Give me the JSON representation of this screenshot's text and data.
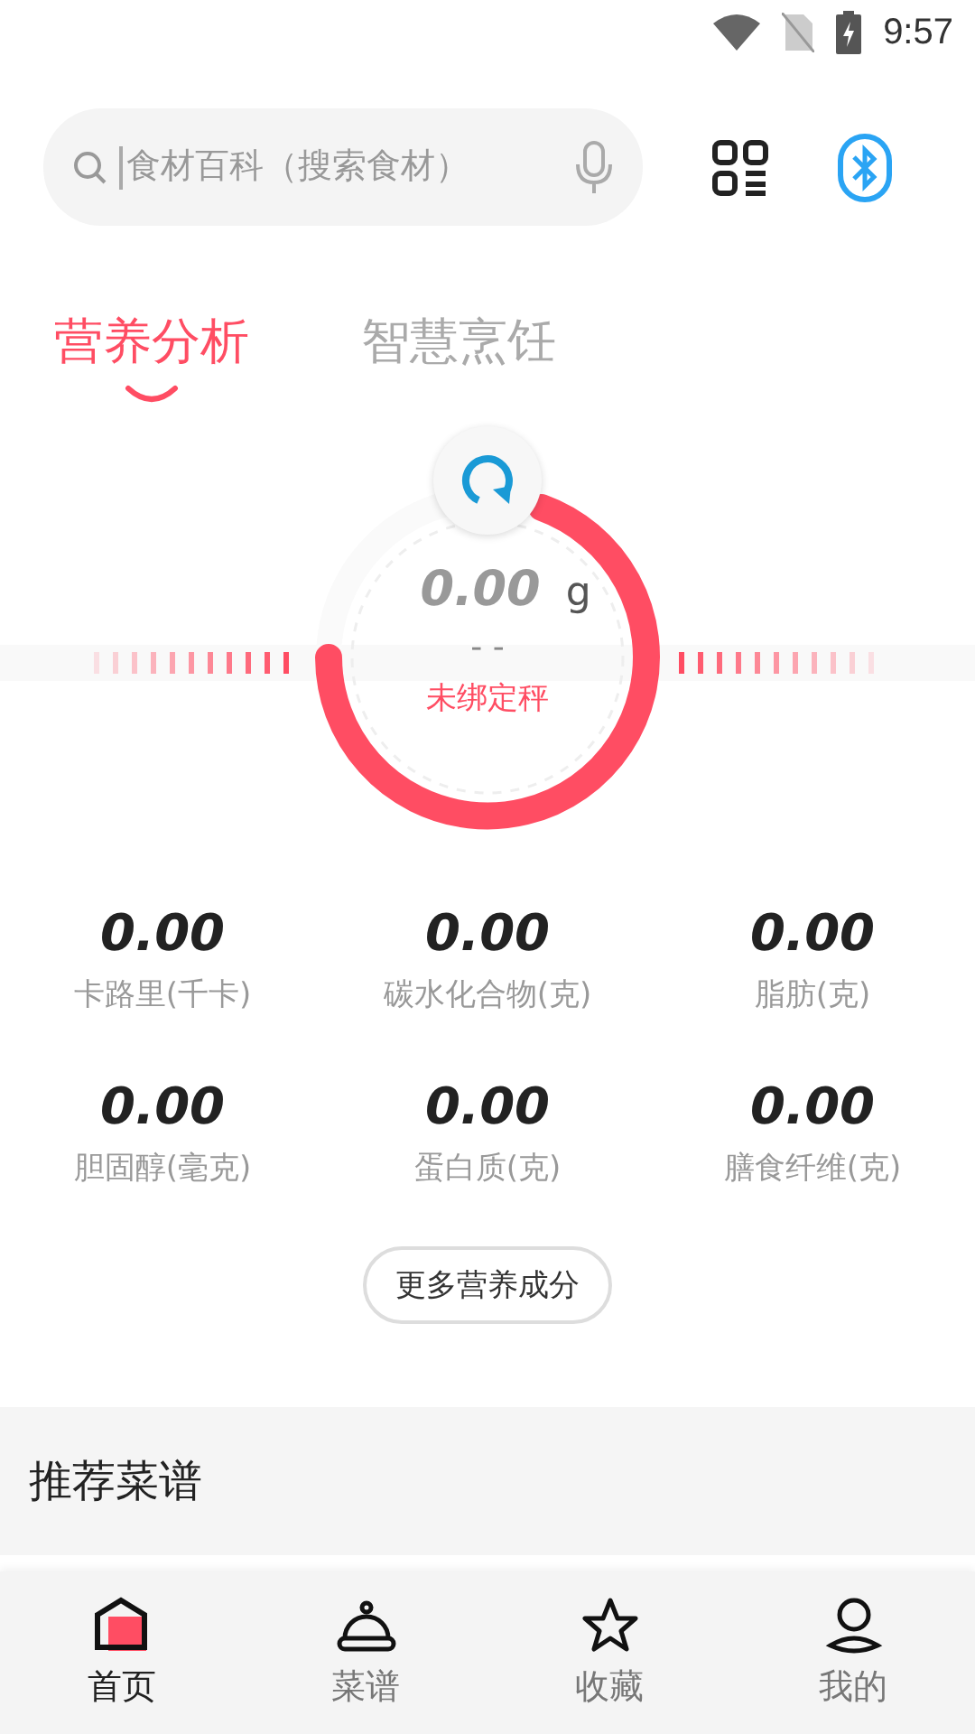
{
  "status_bar": {
    "time": "9:57"
  },
  "search": {
    "placeholder": "食材百科（搜索食材）"
  },
  "tabs": [
    {
      "label": "营养分析",
      "selected": true
    },
    {
      "label": "智慧烹饪",
      "selected": false
    }
  ],
  "scale": {
    "weight": "0.00",
    "unit": "g",
    "reading": "- -",
    "status": "未绑定秤"
  },
  "nutrients": [
    {
      "value": "0.00",
      "label": "卡路里(千卡)"
    },
    {
      "value": "0.00",
      "label": "碳水化合物(克)"
    },
    {
      "value": "0.00",
      "label": "脂肪(克)"
    },
    {
      "value": "0.00",
      "label": "胆固醇(毫克)"
    },
    {
      "value": "0.00",
      "label": "蛋白质(克)"
    },
    {
      "value": "0.00",
      "label": "膳食纤维(克)"
    }
  ],
  "more_button": "更多营养成分",
  "section_title": "推荐菜谱",
  "nav": [
    {
      "kind": "home",
      "label": "首页",
      "selected": true
    },
    {
      "kind": "recipes",
      "label": "菜谱",
      "selected": false
    },
    {
      "kind": "favorites",
      "label": "收藏",
      "selected": false
    },
    {
      "kind": "profile",
      "label": "我的",
      "selected": false
    }
  ]
}
